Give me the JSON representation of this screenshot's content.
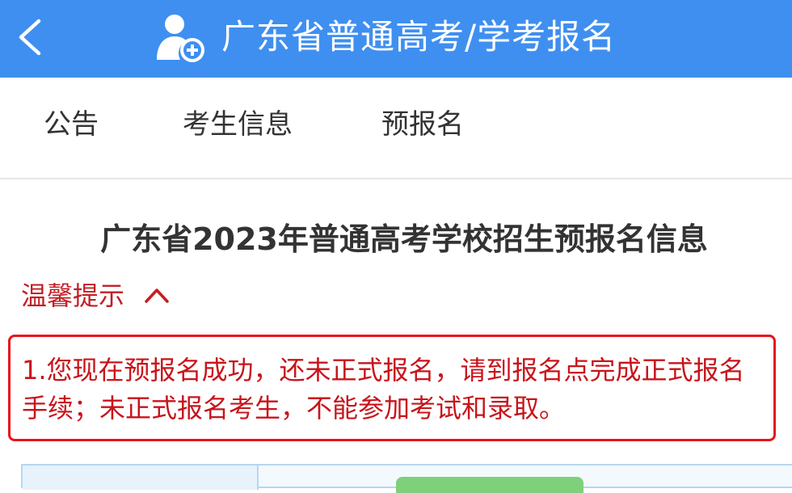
{
  "header": {
    "title": "广东省普通高考/学考报名",
    "back_icon": "chevron-left-icon",
    "user_icon": "user-add-icon"
  },
  "tabs": [
    {
      "label": "公告"
    },
    {
      "label": "考生信息"
    },
    {
      "label": "预报名"
    }
  ],
  "page": {
    "title": "广东省2023年普通高考学校招生预报名信息"
  },
  "tips": {
    "label": "温馨提示",
    "state_icon": "chevron-up-icon",
    "text": "1.您现在预报名成功，还未正式报名，请到报名点完成正式报名手续；未正式报名考生，不能参加考试和录取。"
  },
  "colors": {
    "header_bg": "#3f8ff0",
    "tip_red": "#c41d24",
    "border_red": "#e8141b",
    "table_border": "#b7d6ef",
    "button_green": "#7ed07b"
  }
}
